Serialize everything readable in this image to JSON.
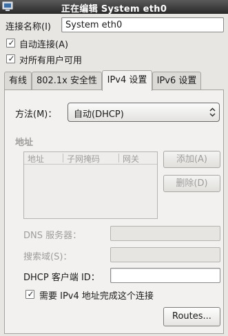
{
  "window": {
    "title": "正在编辑 System eth0",
    "icon": "network-app-icon"
  },
  "connection_name": {
    "label": "连接名称(I)",
    "value": "System eth0"
  },
  "auto_connect": {
    "label": "自动连接(A)",
    "checked": true
  },
  "all_users": {
    "label": "对所有用户可用",
    "checked": true
  },
  "tabs": [
    {
      "label": "有线",
      "active": false
    },
    {
      "label": "802.1x 安全性",
      "active": false
    },
    {
      "label": "IPv4 设置",
      "active": true
    },
    {
      "label": "IPv6 设置",
      "active": false
    }
  ],
  "method": {
    "label": "方法(M)：",
    "value": "自动(DHCP)"
  },
  "address_section": {
    "heading": "地址",
    "columns": [
      "地址",
      "子网掩码",
      "网关"
    ],
    "add_label": "添加(A)",
    "delete_label": "删除(D)"
  },
  "dns": {
    "label": "DNS 服务器：",
    "value": ""
  },
  "search_domains": {
    "label": "搜索域(S)：",
    "value": ""
  },
  "dhcp_client_id": {
    "label": "DHCP 客户端 ID：",
    "value": ""
  },
  "require_ipv4": {
    "label": "需要 IPv4 地址完成这个连接",
    "checked": true
  },
  "routes_button": {
    "label": "Routes..."
  }
}
